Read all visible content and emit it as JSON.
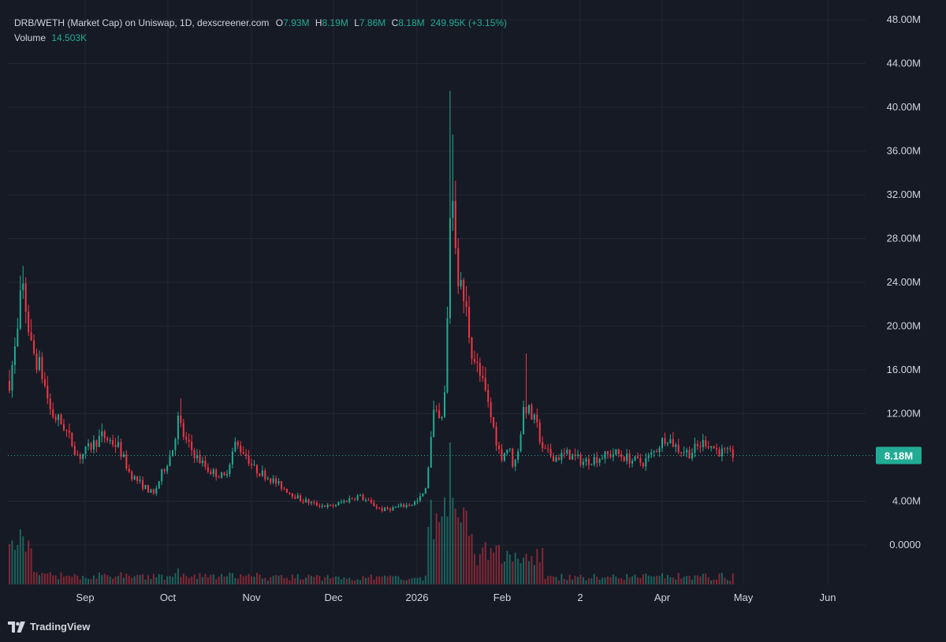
{
  "legend": {
    "title": "DRB/WETH (Market Cap) on Uniswap, 1D, dexscreener.com",
    "o_label": "O",
    "o_value": "7.93M",
    "h_label": "H",
    "h_value": "8.19M",
    "l_label": "L",
    "l_value": "7.86M",
    "c_label": "C",
    "c_value": "8.18M",
    "change": "249.95K (+3.15%)",
    "volume_label": "Volume",
    "volume_value": "14.503K"
  },
  "branding": {
    "name": "TradingView"
  },
  "colors": {
    "up": "#22ab94",
    "down": "#f23645",
    "background": "#161a25",
    "grid": "#232733",
    "text": "#d1d4dc"
  },
  "chart_data": {
    "type": "candlestick",
    "title": "DRB/WETH (Market Cap) on Uniswap, 1D, dexscreener.com",
    "y_ticks": [
      "48.00M",
      "44.00M",
      "40.00M",
      "36.00M",
      "32.00M",
      "28.00M",
      "24.00M",
      "20.00M",
      "16.00M",
      "12.00M",
      "4.00M",
      "0.0000"
    ],
    "y_tick_values": [
      48,
      44,
      40,
      36,
      32,
      28,
      24,
      20,
      16,
      12,
      4,
      0
    ],
    "y_unit": "M",
    "ylim": [
      0,
      48
    ],
    "x_ticks": [
      "Sep",
      "Oct",
      "Nov",
      "Dec",
      "2026",
      "Feb",
      "2",
      "Apr",
      "May",
      "Jun"
    ],
    "last_price_label": "8.18M",
    "last_price_value": 8.18,
    "grid": true,
    "volume_pane": true,
    "key_points": [
      {
        "label": "early Aug",
        "value": 15
      },
      {
        "label": "Aug peak",
        "value": 25.5
      },
      {
        "label": "mid Sep",
        "value": 10
      },
      {
        "label": "late Sep low",
        "value": 4.5
      },
      {
        "label": "Oct spike",
        "value": 13.5
      },
      {
        "label": "Dec low",
        "value": 3.0
      },
      {
        "label": "Jan peak",
        "value": 41.5
      },
      {
        "label": "Feb bounce",
        "value": 17.5
      },
      {
        "label": "Apr level",
        "value": 8.5
      },
      {
        "label": "last close",
        "value": 8.18
      }
    ]
  }
}
